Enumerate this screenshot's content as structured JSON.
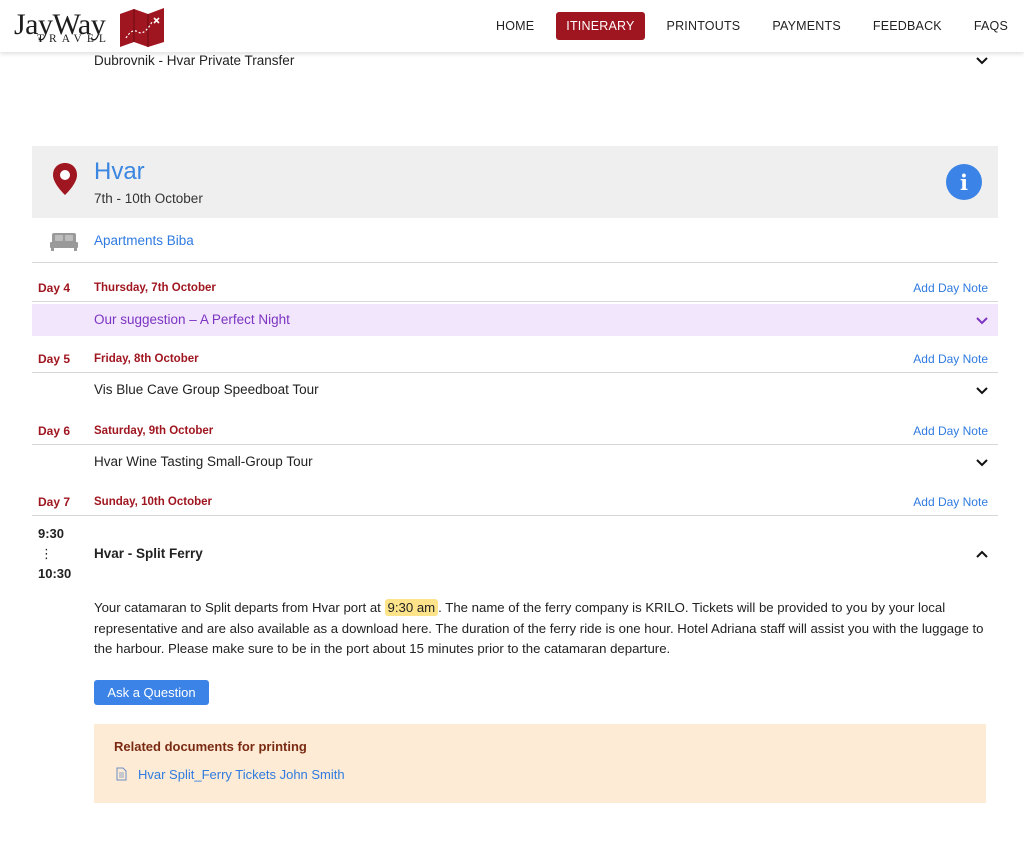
{
  "brand": {
    "name": "JayWay",
    "sub": "TRAVEL",
    "accent": "#a01620"
  },
  "nav": {
    "items": [
      {
        "label": "HOME"
      },
      {
        "label": "ITINERARY",
        "active": true
      },
      {
        "label": "PRINTOUTS"
      },
      {
        "label": "PAYMENTS"
      },
      {
        "label": "FEEDBACK"
      },
      {
        "label": "FAQS"
      }
    ]
  },
  "prior_item": "Dubrovnik - Hvar Private Transfer",
  "location": {
    "name": "Hvar",
    "dates": "7th - 10th October",
    "hotel": "Apartments Biba"
  },
  "add_note_label": "Add Day Note",
  "days": [
    {
      "num": "Day 4",
      "date": "Thursday, 7th October"
    },
    {
      "num": "Day 5",
      "date": "Friday, 8th October"
    },
    {
      "num": "Day 6",
      "date": "Saturday, 9th October"
    },
    {
      "num": "Day 7",
      "date": "Sunday, 10th October"
    }
  ],
  "suggestion": "Our suggestion  – A Perfect Night",
  "items": {
    "day5": "Vis Blue Cave Group Speedboat Tour",
    "day6": "Hvar Wine Tasting Small-Group Tour"
  },
  "ferry": {
    "start": "9:30",
    "sep": "⋮",
    "end": "10:30",
    "title": "Hvar - Split Ferry",
    "text_before": "Your catamaran to Split departs from Hvar port at",
    "time_highlight": "9:30 am",
    "text_after": ". The name of the ferry company is KRILO. Tickets will be provided to you by your local representative and are also available as a download here. The duration of the ferry ride is one hour. Hotel Adriana staff will assist you with the luggage to the harbour. Please make sure to be in the port about 15 minutes prior to the catamaran departure.",
    "ask_button": "Ask a Question",
    "docs_title": "Related documents for printing",
    "doc_link": "Hvar Split_Ferry Tickets John Smith"
  }
}
